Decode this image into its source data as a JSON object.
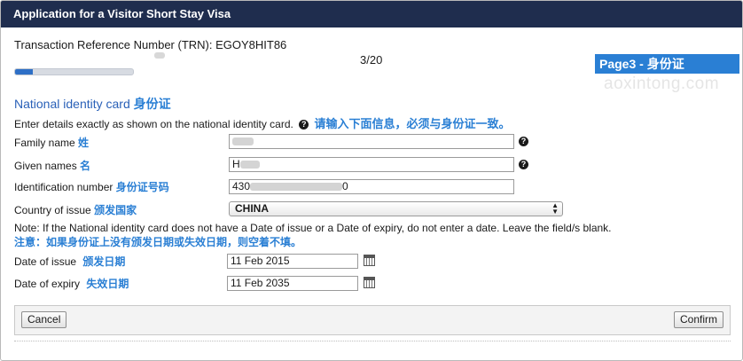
{
  "window": {
    "title": "Application for a Visitor Short Stay Visa"
  },
  "header": {
    "trn_label": "Transaction Reference Number (TRN): EGOY8HIT86",
    "page_indicator": "3/20",
    "progress_fraction": 0.15
  },
  "annotation": {
    "badge": "Page3 - 身份证",
    "watermark": "aoxintong.com"
  },
  "section": {
    "title": "National identity card",
    "title_cn": "身份证",
    "instruction": "Enter details exactly as shown on the national identity card.",
    "instruction_cn": "请输入下面信息，必须与身份证一致。"
  },
  "form": {
    "family_name": {
      "label": "Family name",
      "label_cn": "姓",
      "value": ""
    },
    "given_names": {
      "label": "Given names",
      "label_cn": "名",
      "value": "H"
    },
    "identification_number": {
      "label": "Identification number",
      "label_cn": "身份证号码",
      "value_start": "430",
      "value_end": "0"
    },
    "country_of_issue": {
      "label": "Country of issue",
      "label_cn": "颁发国家",
      "value": "CHINA"
    },
    "note": "Note: If the National identity card does not have a Date of issue or a Date of expiry, do not enter a date. Leave the field/s blank.",
    "note_cn": "注意：如果身份证上没有颁发日期或失效日期，则空着不填。",
    "date_of_issue": {
      "label": "Date of issue",
      "label_cn": "颁发日期",
      "value": "11 Feb 2015"
    },
    "date_of_expiry": {
      "label": "Date of expiry",
      "label_cn": "失效日期",
      "value": "11 Feb 2035"
    }
  },
  "footer": {
    "cancel_label": "Cancel",
    "confirm_label": "Confirm"
  },
  "icons": {
    "help": "help-icon",
    "calendar": "calendar-icon",
    "select_arrows": "select-arrows-icon"
  },
  "colors": {
    "titlebar": "#1f2d4e",
    "accent": "#2a7fd4",
    "section_title": "#2a61b8"
  }
}
